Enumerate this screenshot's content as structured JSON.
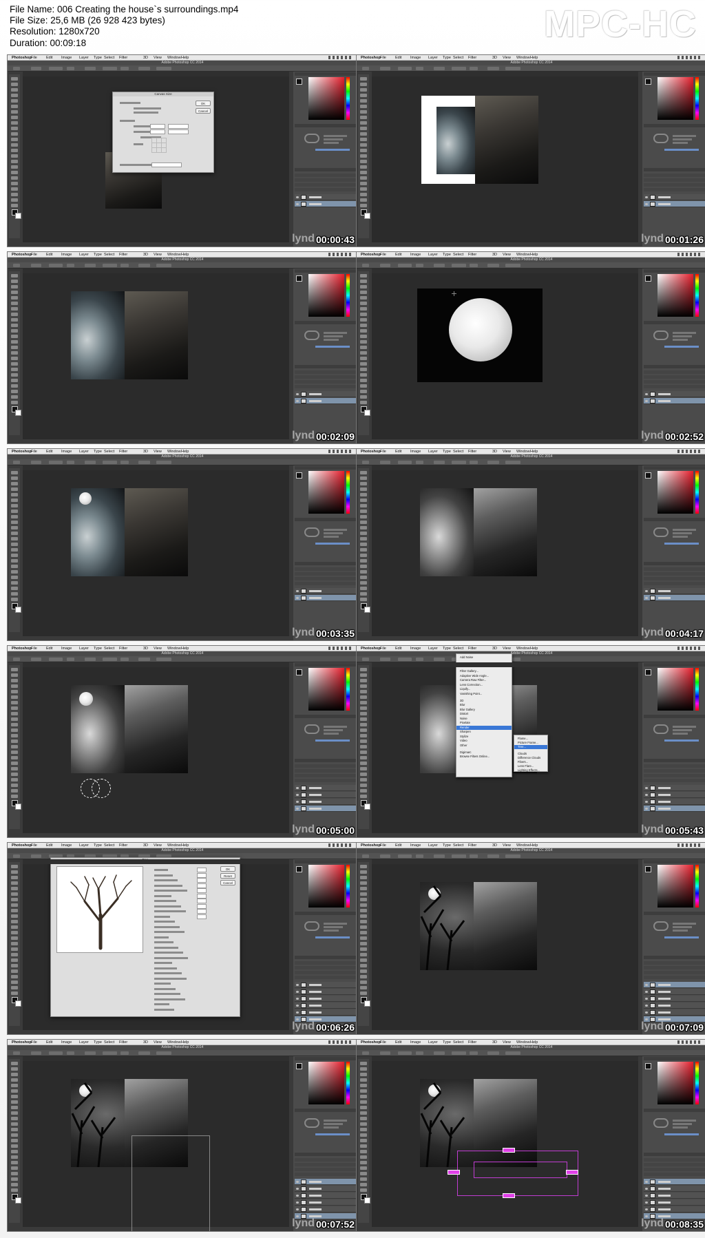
{
  "file_info": {
    "name": "File Name: 006 Creating the house`s surroundings.mp4",
    "size": "File Size: 25,6 MB (26 928 423 bytes)",
    "resolution": "Resolution: 1280x720",
    "duration": "Duration: 00:09:18"
  },
  "brand": "MPC-HC",
  "app": {
    "title": "Adobe Photoshop CC 2014",
    "menu": [
      "Photoshop",
      "File",
      "Edit",
      "Image",
      "Layer",
      "Type",
      "Select",
      "Filter",
      "3D",
      "View",
      "Window",
      "Help"
    ],
    "watermark": "lynd"
  },
  "thumbnails": [
    {
      "timecode": "00:00:43",
      "scene": "canvas-size-dialog"
    },
    {
      "timecode": "00:01:26",
      "scene": "sky-placed"
    },
    {
      "timecode": "00:02:09",
      "scene": "sky-and-house"
    },
    {
      "timecode": "00:02:52",
      "scene": "moon"
    },
    {
      "timecode": "00:03:35",
      "scene": "moon-added"
    },
    {
      "timecode": "00:04:17",
      "scene": "grayscale"
    },
    {
      "timecode": "00:05:00",
      "scene": "selection"
    },
    {
      "timecode": "00:05:43",
      "scene": "filter-render-menu"
    },
    {
      "timecode": "00:06:26",
      "scene": "tree-dialog"
    },
    {
      "timecode": "00:07:09",
      "scene": "trees-added"
    },
    {
      "timecode": "00:07:52",
      "scene": "tree-transform"
    },
    {
      "timecode": "00:08:35",
      "scene": "transform-handles"
    }
  ],
  "canvas_size_dialog": {
    "title": "Canvas Size",
    "ok": "OK",
    "cancel": "Cancel"
  },
  "filter_menu": {
    "items": [
      "Add Noise",
      "Convert for Smart Filters",
      "Filter Gallery...",
      "Adaptive Wide Angle...",
      "Camera Raw Filter...",
      "Lens Correction...",
      "Liquify...",
      "Vanishing Point...",
      "3D",
      "Blur",
      "Blur Gallery",
      "Distort",
      "Noise",
      "Pixelate",
      "Render",
      "Sharpen",
      "Stylize",
      "Video",
      "Other",
      "Digimarc",
      "Browse Filters Online..."
    ],
    "render_submenu": [
      "Flame...",
      "Picture Frame...",
      "Tree...",
      "Clouds",
      "Difference Clouds",
      "Fibers...",
      "Lens Flare...",
      "Lighting Effects..."
    ]
  },
  "tree_dialog": {
    "title": "Tree",
    "ok": "OK",
    "reset": "Reset",
    "cancel": "Cancel"
  }
}
